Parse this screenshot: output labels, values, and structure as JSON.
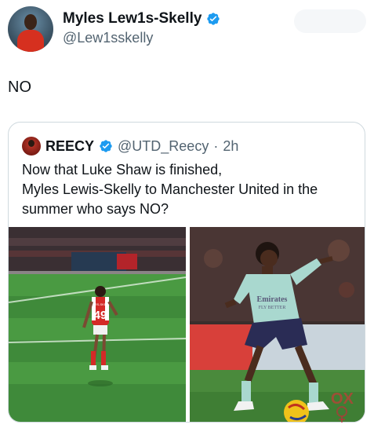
{
  "author": {
    "display_name": "Myles Lew1s-Skelly",
    "handle": "@Lew1sskelly",
    "verified": true
  },
  "tweet": {
    "text": "NO"
  },
  "quoted": {
    "display_name": "REECY",
    "handle": "@UTD_Reecy",
    "separator": "·",
    "time": "2h",
    "lines": [
      "Now that Luke Shaw is finished,",
      "Myles Lewis-Skelly to Manchester United in the",
      "summer who says NO?"
    ]
  },
  "media": {
    "left_shirt_number": "49",
    "left_shirt_name": "LEWIS-SKELLY",
    "right_sponsor": "Emirates",
    "right_sponsor_sub": "FLY BETTER"
  },
  "colors": {
    "verified_blue": "#1d9bf0",
    "secondary_text": "#536471",
    "border": "#cfd9de"
  }
}
